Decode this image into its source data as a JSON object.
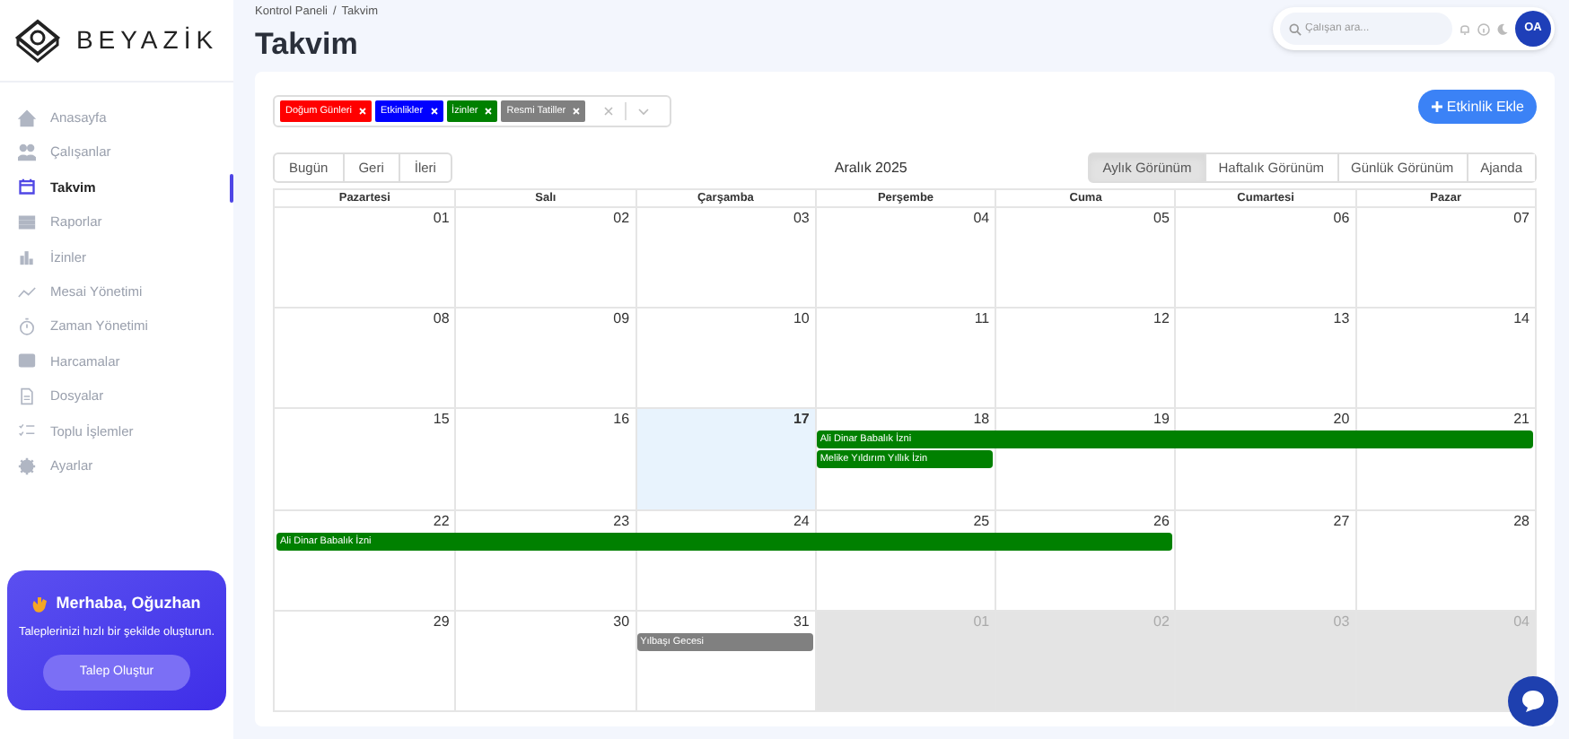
{
  "brand": {
    "name": "BEYAZİK"
  },
  "sidebar": {
    "items": [
      {
        "label": "Anasayfa",
        "selected": false
      },
      {
        "label": "Çalışanlar",
        "selected": false
      },
      {
        "label": "Takvim",
        "selected": true
      },
      {
        "label": "Raporlar",
        "selected": false
      },
      {
        "label": "İzinler",
        "selected": false
      },
      {
        "label": "Mesai Yönetimi",
        "selected": false
      },
      {
        "label": "Zaman Yönetimi",
        "selected": false
      },
      {
        "label": "Harcamalar",
        "selected": false
      },
      {
        "label": "Dosyalar",
        "selected": false
      },
      {
        "label": "Toplu İşlemler",
        "selected": false
      },
      {
        "label": "Ayarlar",
        "selected": false
      }
    ]
  },
  "promo": {
    "title": "Merhaba, Oğuzhan",
    "text": "Taleplerinizi hızlı bir şekilde oluşturun.",
    "button": "Talep Oluştur"
  },
  "breadcrumb": [
    "Kontrol Paneli",
    "Takvim"
  ],
  "breadcrumb_separator": "/",
  "page_title": "Takvim",
  "search": {
    "placeholder": "Çalışan ara..."
  },
  "avatar": {
    "initials": "OA"
  },
  "filters": [
    {
      "label": "Doğum Günleri",
      "color": "#ff0000"
    },
    {
      "label": "Etkinlikler",
      "color": "#0000ff"
    },
    {
      "label": "İzinler",
      "color": "#008000"
    },
    {
      "label": "Resmi Tatiller",
      "color": "#808080"
    }
  ],
  "add_button": "Etkinlik Ekle",
  "nav_buttons": [
    "Bugün",
    "Geri",
    "İleri"
  ],
  "month_label": "Aralık 2025",
  "views": [
    {
      "label": "Aylık Görünüm",
      "selected": true
    },
    {
      "label": "Haftalık Görünüm",
      "selected": false
    },
    {
      "label": "Günlük Görünüm",
      "selected": false
    },
    {
      "label": "Ajanda",
      "selected": false
    }
  ],
  "weekdays": [
    "Pazartesi",
    "Salı",
    "Çarşamba",
    "Perşembe",
    "Cuma",
    "Cumartesi",
    "Pazar"
  ],
  "weeks": [
    {
      "days": [
        {
          "date": "01",
          "today": false,
          "outside": false
        },
        {
          "date": "02",
          "today": false,
          "outside": false
        },
        {
          "date": "03",
          "today": false,
          "outside": false
        },
        {
          "date": "04",
          "today": false,
          "outside": false
        },
        {
          "date": "05",
          "today": false,
          "outside": false
        },
        {
          "date": "06",
          "today": false,
          "outside": false
        },
        {
          "date": "07",
          "today": false,
          "outside": false
        }
      ]
    },
    {
      "days": [
        {
          "date": "08",
          "today": false,
          "outside": false
        },
        {
          "date": "09",
          "today": false,
          "outside": false
        },
        {
          "date": "10",
          "today": false,
          "outside": false
        },
        {
          "date": "11",
          "today": false,
          "outside": false
        },
        {
          "date": "12",
          "today": false,
          "outside": false
        },
        {
          "date": "13",
          "today": false,
          "outside": false
        },
        {
          "date": "14",
          "today": false,
          "outside": false
        }
      ]
    },
    {
      "days": [
        {
          "date": "15",
          "today": false,
          "outside": false
        },
        {
          "date": "16",
          "today": false,
          "outside": false
        },
        {
          "date": "17",
          "today": true,
          "outside": false
        },
        {
          "date": "18",
          "today": false,
          "outside": false
        },
        {
          "date": "19",
          "today": false,
          "outside": false
        },
        {
          "date": "20",
          "today": false,
          "outside": false
        },
        {
          "date": "21",
          "today": false,
          "outside": false
        }
      ],
      "lanes": [
        [
          {
            "kind": "empty"
          },
          {
            "kind": "empty"
          },
          {
            "kind": "empty"
          },
          {
            "kind": "event",
            "label": "Ali Dinar Babalık İzni",
            "color": "#008000"
          },
          {
            "kind": "continued"
          },
          {
            "kind": "continued"
          },
          {
            "kind": "continued"
          }
        ],
        [
          {
            "kind": "empty"
          },
          {
            "kind": "empty"
          },
          {
            "kind": "empty"
          },
          {
            "kind": "event",
            "label": "Melike Yıldırım Yıllık İzin",
            "color": "#008000"
          },
          {
            "kind": "empty"
          },
          {
            "kind": "empty"
          },
          {
            "kind": "empty"
          }
        ]
      ]
    },
    {
      "days": [
        {
          "date": "22",
          "today": false,
          "outside": false
        },
        {
          "date": "23",
          "today": false,
          "outside": false
        },
        {
          "date": "24",
          "today": false,
          "outside": false
        },
        {
          "date": "25",
          "today": false,
          "outside": false
        },
        {
          "date": "26",
          "today": false,
          "outside": false
        },
        {
          "date": "27",
          "today": false,
          "outside": false
        },
        {
          "date": "28",
          "today": false,
          "outside": false
        }
      ],
      "lanes": [
        [
          {
            "kind": "event",
            "label": "Ali Dinar Babalık İzni",
            "color": "#008000"
          },
          {
            "kind": "continued"
          },
          {
            "kind": "continued"
          },
          {
            "kind": "continued"
          },
          {
            "kind": "continued"
          },
          {
            "kind": "empty"
          },
          {
            "kind": "empty"
          }
        ]
      ]
    },
    {
      "days": [
        {
          "date": "29",
          "today": false,
          "outside": false
        },
        {
          "date": "30",
          "today": false,
          "outside": false
        },
        {
          "date": "31",
          "today": false,
          "outside": false
        },
        {
          "date": "01",
          "today": false,
          "outside": true
        },
        {
          "date": "02",
          "today": false,
          "outside": true
        },
        {
          "date": "03",
          "today": false,
          "outside": true
        },
        {
          "date": "04",
          "today": false,
          "outside": true
        }
      ],
      "lanes": [
        [
          {
            "kind": "empty"
          },
          {
            "kind": "empty"
          },
          {
            "kind": "event",
            "label": "Yılbaşı Gecesi",
            "color": "#808080"
          },
          {
            "kind": "empty"
          },
          {
            "kind": "empty"
          },
          {
            "kind": "empty"
          },
          {
            "kind": "empty"
          }
        ]
      ]
    }
  ]
}
